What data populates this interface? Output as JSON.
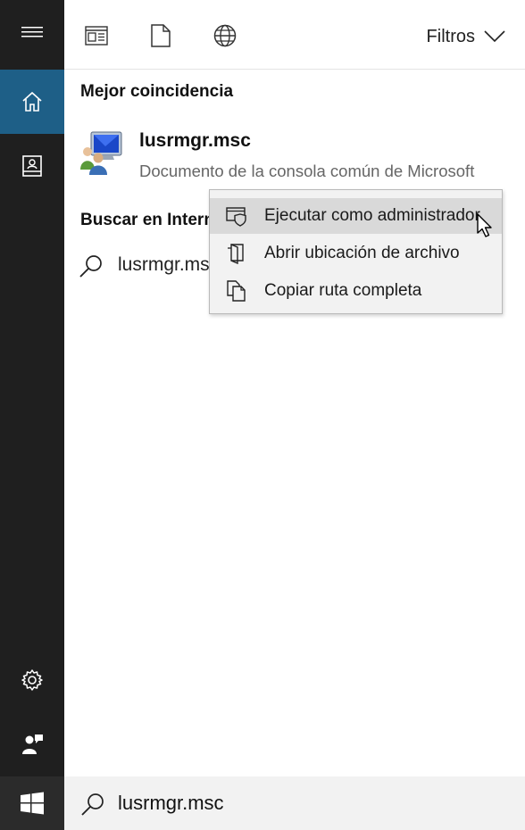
{
  "toolbar": {
    "icons": [
      "apps-icon",
      "documents-icon",
      "web-icon"
    ],
    "filters_label": "Filtros"
  },
  "sidebar": {
    "items": [
      "home-icon",
      "notebook-icon",
      "settings-icon",
      "feedback-icon"
    ]
  },
  "best_match": {
    "heading": "Mejor coincidencia",
    "title": "lusrmgr.msc",
    "subtitle": "Documento de la consola común de Microsoft"
  },
  "web": {
    "heading": "Buscar en Intern",
    "query": "lusrmgr.ms"
  },
  "context_menu": {
    "items": [
      {
        "label": "Ejecutar como administrador",
        "icon": "shield-icon",
        "hovered": true
      },
      {
        "label": "Abrir ubicación de archivo",
        "icon": "folder-open-icon",
        "hovered": false
      },
      {
        "label": "Copiar ruta completa",
        "icon": "copy-icon",
        "hovered": false
      }
    ]
  },
  "search": {
    "value": "lusrmgr.msc"
  },
  "colors": {
    "rail_bg": "#1f1f1f",
    "rail_active": "#1e5f87",
    "menu_bg": "#f2f2f2",
    "menu_hover": "#d9d9d9"
  }
}
